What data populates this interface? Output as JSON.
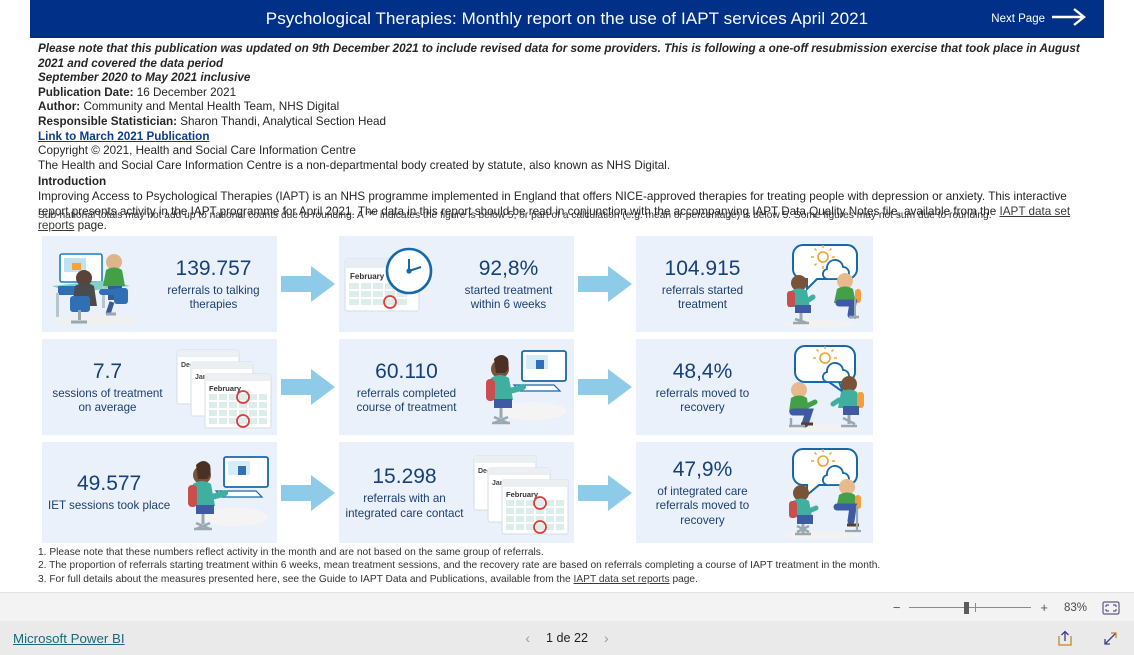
{
  "header": {
    "title": "Psychological Therapies: Monthly report on the use of IAPT services April 2021",
    "next_page_label": "Next Page",
    "bg_color": "#003087"
  },
  "notes": {
    "update_note_line1": "Please note that this publication was updated on 9th December 2021 to include revised data for some providers. This is following a one-off resubmission exercise that took place in August 2021 and covered the data period",
    "update_note_line2": "September 2020 to May 2021 inclusive",
    "publication_date_label": "Publication Date:",
    "publication_date_value": "16 December 2021",
    "author_label": "Author:",
    "author_value": "Community and Mental Health Team, NHS Digital",
    "statistician_label": "Responsible Statistician:",
    "statistician_value": "Sharon Thandi, Analytical Section Head",
    "march_link": "Link to March 2021 Publication",
    "copyright": "Copyright © 2021, Health and Social Care Information Centre",
    "hscic_note": "The Health and Social Care Information Centre is a non-departmental body created by statute, also known as NHS Digital.",
    "introduction_heading": "Introduction",
    "intro_part1": "Improving Access to Psychological Therapies (IAPT) is an NHS programme implemented in England that offers NICE-approved therapies for treating people with depression or anxiety. This interactive report presents activity in the IAPT programme for April 2021. The data in this report should be read in conjunction with the accompanying IAPT Data Quality Notes file, available from the ",
    "intro_link": "IAPT data set reports",
    "intro_part2": " page.",
    "rounding_note": "Sub-national totals may not add up to national counts due to rounding. A \"*\" indicates the figure is below 5, or part of a calculation (e.g. mean or percentage) is below 5. Some figures may not sum due to rounding."
  },
  "infographic": {
    "rows": [
      {
        "cards": [
          {
            "value": "139.757",
            "label": "referrals to talking therapies",
            "art": "therapy-desk-icon",
            "art_side": "left"
          },
          {
            "value": "92,8%",
            "label": "started treatment within 6 weeks",
            "art": "calendar-clock-icon",
            "art_side": "left"
          },
          {
            "value": "104.915",
            "label": "referrals started treatment",
            "art": "counselling-weather-icon",
            "art_side": "right"
          }
        ]
      },
      {
        "cards": [
          {
            "value": "7.7",
            "label": "sessions of treatment on average",
            "art": "calendar-stack-icon",
            "art_side": "right"
          },
          {
            "value": "60.110",
            "label": "referrals completed course of treatment",
            "art": "online-session-icon",
            "art_side": "right"
          },
          {
            "value": "48,4%",
            "label": "referrals moved to recovery",
            "art": "counselling-weather-icon",
            "art_side": "right"
          }
        ]
      },
      {
        "cards": [
          {
            "value": "49.577",
            "label": "IET sessions took place",
            "art": "online-session-icon",
            "art_side": "right"
          },
          {
            "value": "15.298",
            "label": "referrals with an integrated care contact",
            "art": "calendar-stack-icon",
            "art_side": "right"
          },
          {
            "value": "47,9%",
            "label": "of integrated care referrals moved to recovery",
            "art": "counselling-weather-icon",
            "art_side": "right"
          }
        ]
      }
    ],
    "card_bg": "#eaf1fa",
    "value_color": "#16407c",
    "arrow_color": "#8ecbe8"
  },
  "footnotes": {
    "note1": "1. Please note that these numbers reflect activity in the month and are not based on the same group of referrals.",
    "note2": "2. The proportion of referrals starting treatment within 6 weeks, mean treatment sessions, and the recovery rate are based on referrals completing a course of IAPT treatment in the month.",
    "note3_part1": "3. For full details about the measures presented here, see the Guide to IAPT Data and Publications, available from the ",
    "note3_link": "IAPT data set reports",
    "note3_part2": " page."
  },
  "zoombar": {
    "minus": "−",
    "plus": "+",
    "level": "83%",
    "fit_icon": "fit-to-page-icon"
  },
  "statusbar": {
    "brand": "Microsoft Power BI",
    "prev_icon": "‹",
    "next_icon": "›",
    "page_indicator": "1 de 22",
    "share_icon": "share-icon",
    "fullscreen_icon": "fullscreen-icon"
  }
}
